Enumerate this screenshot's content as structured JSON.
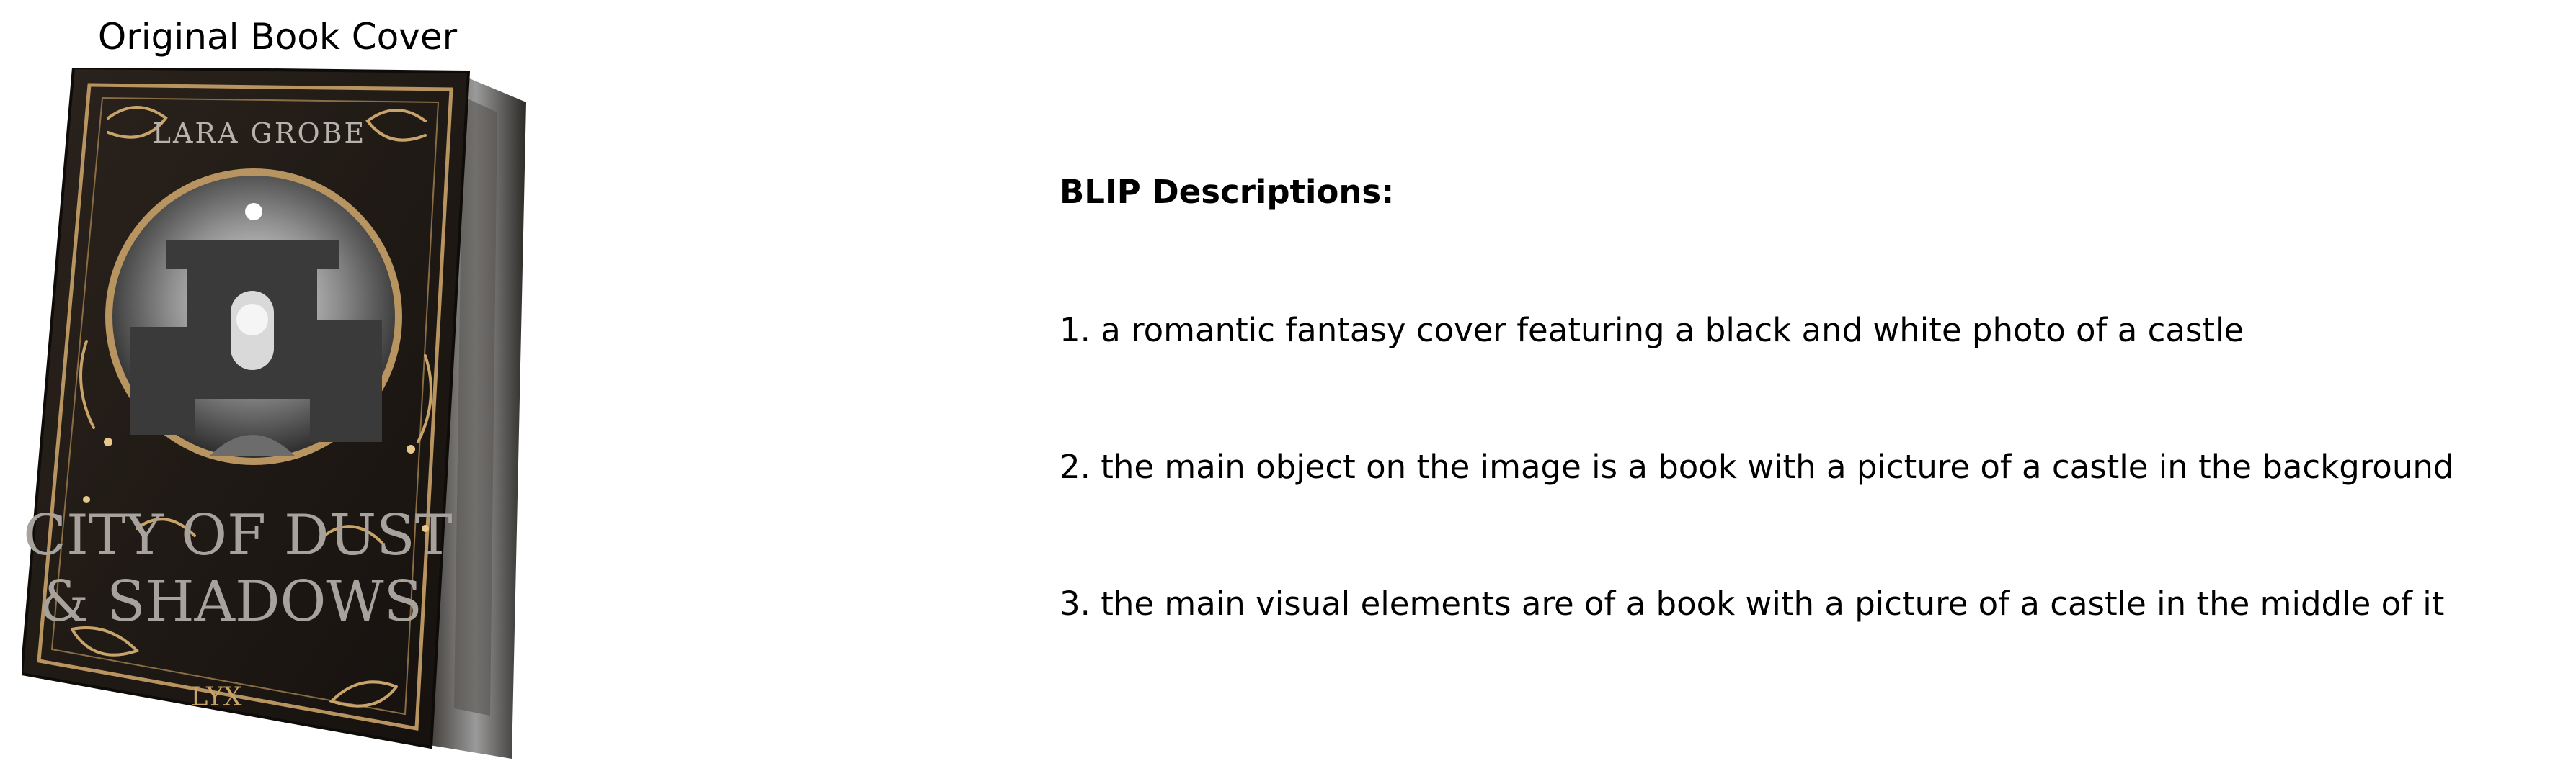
{
  "left_panel": {
    "title": "Original Book Cover"
  },
  "book_cover": {
    "author": "LARA GROBE",
    "title_line_1": "CITY OF DUST",
    "title_line_2": "& SHADOWS",
    "publisher": "LYX",
    "palette": {
      "cover": "#1f1915",
      "gold": "#b89460",
      "silver": "#c8c8c8",
      "spine": "#2a2622"
    }
  },
  "right_panel": {
    "heading": "BLIP Descriptions:",
    "descriptions": [
      "1. a romantic fantasy cover featuring a black and white photo of a castle",
      "2. the main object on the image is a book with a picture of a castle in the background",
      "3. the main visual elements are of a book with a picture of a castle in the middle of it"
    ]
  }
}
